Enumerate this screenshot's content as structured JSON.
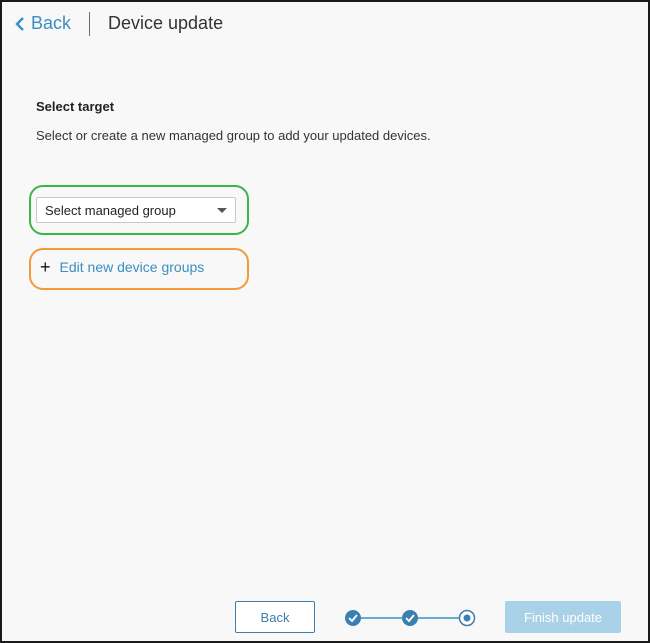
{
  "header": {
    "back_label": "Back",
    "title": "Device update"
  },
  "main": {
    "section_title": "Select target",
    "description": "Select or create a new managed group to add your updated devices.",
    "select": {
      "value": "Select managed group"
    },
    "add_link": {
      "plus": "+",
      "label": "Edit new device groups"
    }
  },
  "footer": {
    "back_label": "Back",
    "finish_label": "Finish update",
    "stepper": {
      "steps_completed": 2,
      "steps_total": 3,
      "current_step": 3
    }
  },
  "colors": {
    "accent": "#3b8fc2",
    "highlight_green": "#3cb54a",
    "highlight_orange": "#f39a3c",
    "disabled_button": "#a9d1e8"
  }
}
